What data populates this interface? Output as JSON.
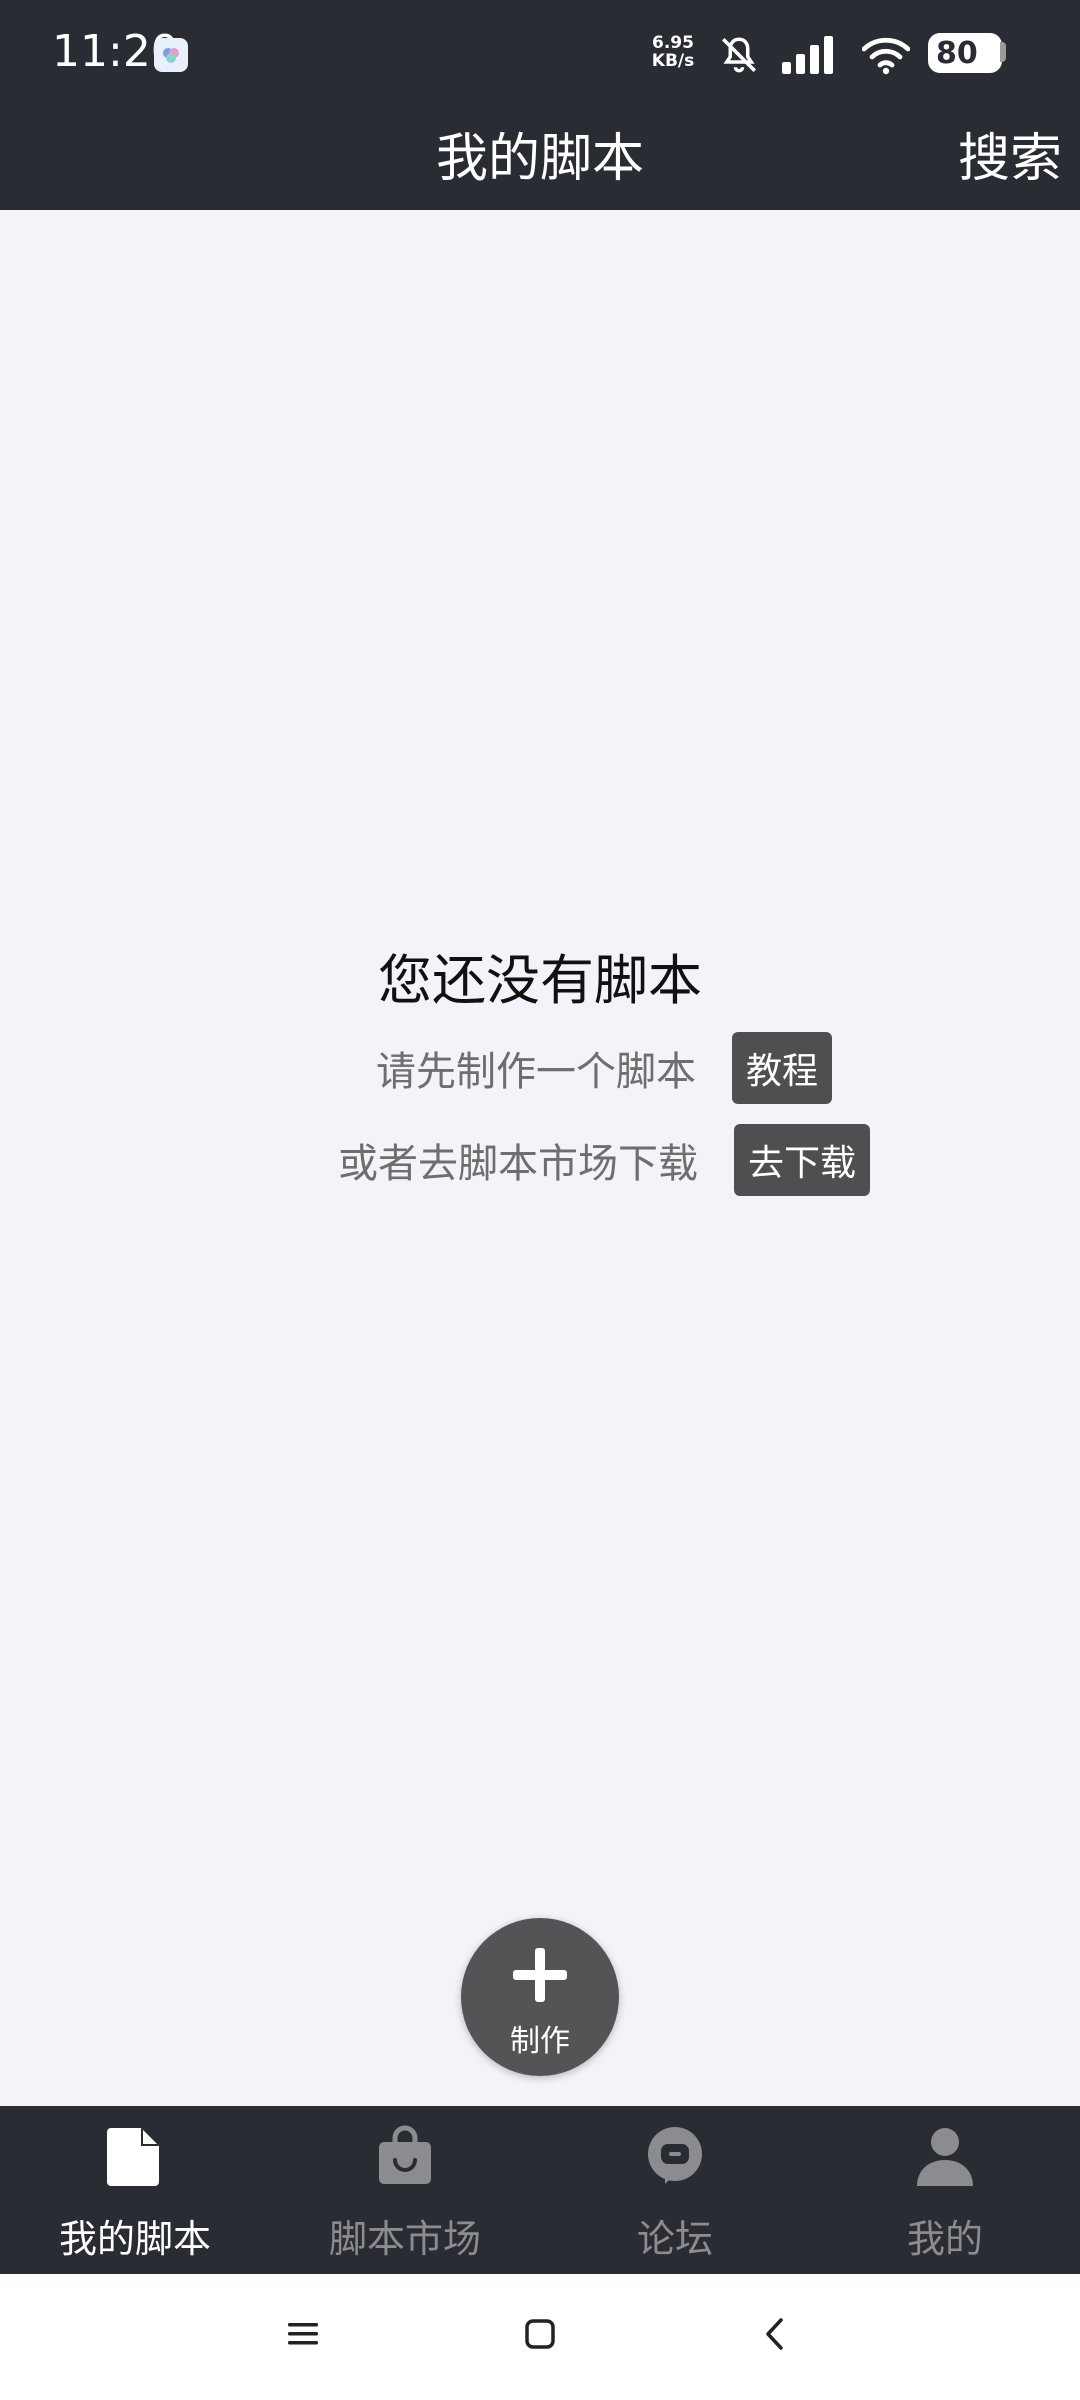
{
  "status": {
    "time": "11:20",
    "net_speed_value": "6.95",
    "net_speed_unit": "KB/s",
    "battery": "80",
    "icons": [
      "app-badge-icon",
      "mute-bell-icon",
      "signal-icon",
      "wifi-icon",
      "battery-icon"
    ]
  },
  "header": {
    "title": "我的脚本",
    "search": "搜索"
  },
  "empty_state": {
    "title": "您还没有脚本",
    "line1": "请先制作一个脚本",
    "tutorial_button": "教程",
    "line2": "或者去脚本市场下载",
    "download_button": "去下载"
  },
  "fab": {
    "label": "制作",
    "icon": "plus-icon"
  },
  "nav": {
    "items": [
      {
        "label": "我的脚本",
        "icon": "document-icon",
        "active": true
      },
      {
        "label": "脚本市场",
        "icon": "shopping-bag-icon",
        "active": false
      },
      {
        "label": "论坛",
        "icon": "chat-bubble-icon",
        "active": false
      },
      {
        "label": "我的",
        "icon": "person-icon",
        "active": false
      }
    ]
  },
  "colors": {
    "bar": "#2a2c33",
    "background": "#f3f3f9",
    "button": "#4f4f52",
    "inactive": "#8b8b90"
  }
}
